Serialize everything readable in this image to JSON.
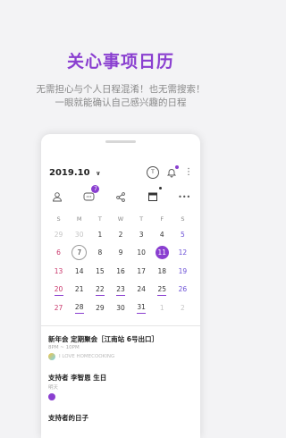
{
  "hero": {
    "title": "关心事项日历",
    "line1": "无需担心与个人日程混淆！也无需搜索！",
    "line2": "一眼就能确认自己感兴趣的日程"
  },
  "header": {
    "month": "2019.10",
    "dropdown_glyph": "∨",
    "circle_icon_label": "T",
    "more_glyph": "⋮"
  },
  "toolbar": {
    "badge_count": "7",
    "more_glyph": "•••"
  },
  "calendar": {
    "weekdays": [
      "S",
      "M",
      "T",
      "W",
      "T",
      "F",
      "S"
    ],
    "weeks": [
      [
        "29",
        "30",
        "1",
        "2",
        "3",
        "4",
        "5"
      ],
      [
        "6",
        "7",
        "8",
        "9",
        "10",
        "11",
        "12"
      ],
      [
        "13",
        "14",
        "15",
        "16",
        "17",
        "18",
        "19"
      ],
      [
        "20",
        "21",
        "22",
        "23",
        "24",
        "25",
        "26"
      ],
      [
        "27",
        "28",
        "29",
        "30",
        "31",
        "1",
        "2"
      ]
    ]
  },
  "events": [
    {
      "title": "新年会 定期聚会［江南站 6号出口］",
      "sub": "8PM ~ 10PM",
      "meta": "I LOVE HOMECOOKING"
    },
    {
      "title": "支持者 李智恩 生日",
      "sub": "明天",
      "meta": ""
    },
    {
      "title": "支持者的日子",
      "sub": "",
      "meta": ""
    }
  ],
  "colors": {
    "accent": "#8a3fd0",
    "sunday": "#c9356a",
    "saturday": "#6a4fd6"
  }
}
